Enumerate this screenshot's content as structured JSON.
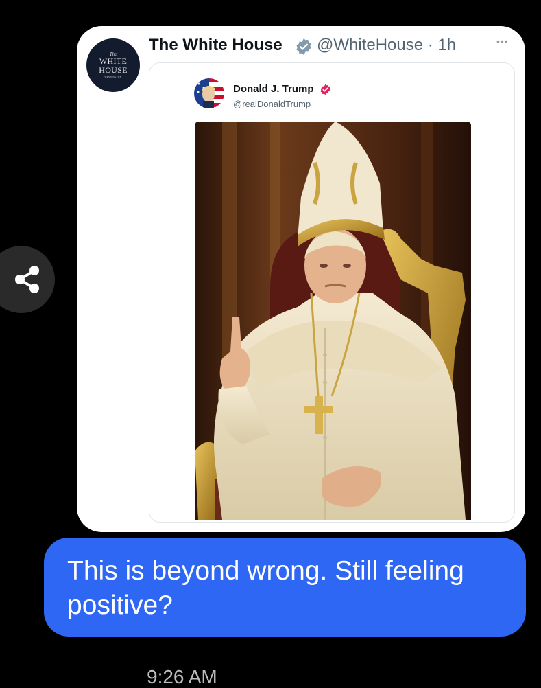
{
  "share": {
    "icon": "share-icon"
  },
  "tweet": {
    "avatar_text": {
      "small": "The",
      "line1": "WHITE",
      "line2": "HOUSE",
      "tiny": "WASHINGTON"
    },
    "name": "The White House",
    "handle": "@WhiteHouse · 1h",
    "more": "•••",
    "quote": {
      "name": "Donald J. Trump",
      "handle": "@realDonaldTrump"
    }
  },
  "message": {
    "text": "This is beyond wrong. Still feeling positive?",
    "time": "9:26 AM",
    "bubble_color": "#2f67f5"
  },
  "colors": {
    "badge_gray": "#829aab",
    "badge_pink": "#e0245e"
  }
}
